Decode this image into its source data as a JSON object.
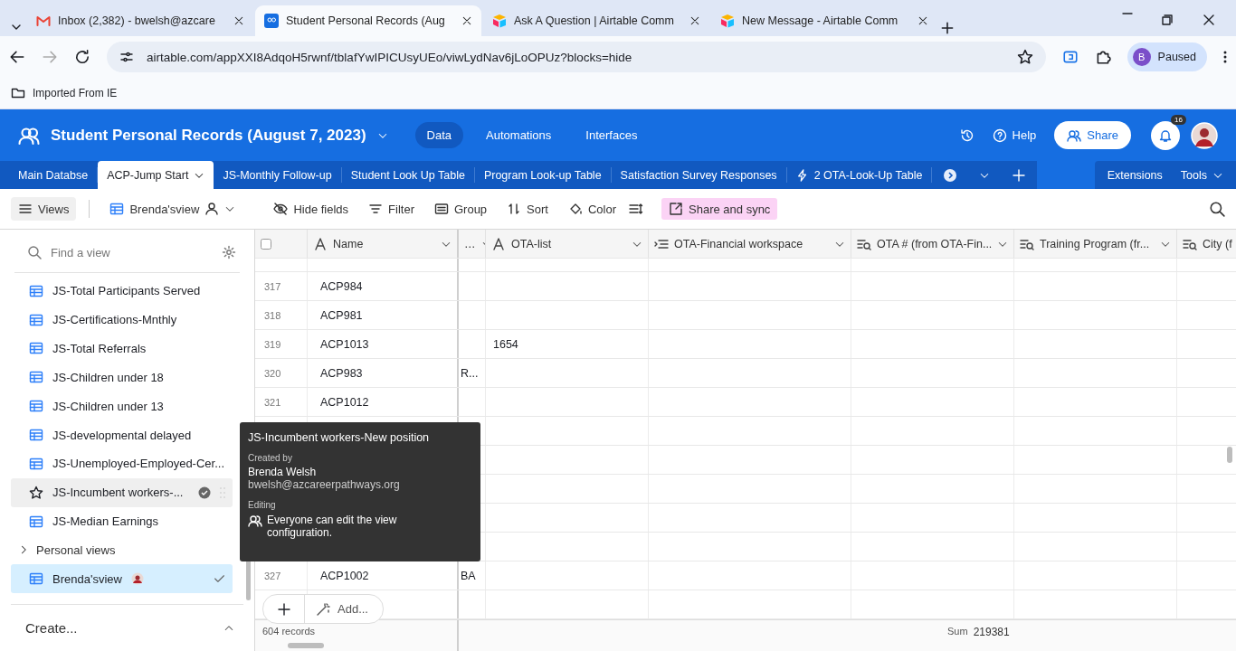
{
  "browser": {
    "tabs": [
      {
        "title": "Inbox (2,382) - bwelsh@azcare",
        "kind": "mail",
        "selected": false
      },
      {
        "title": "Student Personal Records (Aug",
        "kind": "people",
        "selected": true
      },
      {
        "title": "Ask A Question | Airtable Comm",
        "kind": "airtable",
        "selected": false
      },
      {
        "title": "New Message - Airtable Comm",
        "kind": "airtable",
        "selected": false
      }
    ],
    "address": "airtable.com/appXXI8AdqoH5rwnf/tblafYwIPICUsyUEo/viwLydNav6jLoOPUz?blocks=hide",
    "profile_initial": "B",
    "profile_label": "Paused",
    "bookmarks": [
      "Imported From IE"
    ]
  },
  "app": {
    "base_title": "Student Personal Records (August 7, 2023)",
    "nav": [
      {
        "label": "Data",
        "selected": true
      },
      {
        "label": "Automations",
        "selected": false
      },
      {
        "label": "Interfaces",
        "selected": false
      }
    ],
    "help": "Help",
    "share": "Share",
    "notifications": "16"
  },
  "table_tabs": [
    {
      "label": "Main Databse",
      "selected": false
    },
    {
      "label": "ACP-Jump Start",
      "selected": true
    },
    {
      "label": "JS-Monthly Follow-up",
      "selected": false
    },
    {
      "label": "Student Look Up Table",
      "selected": false
    },
    {
      "label": "Program Look-up Table",
      "selected": false
    },
    {
      "label": "Satisfaction Survey Responses",
      "selected": false
    },
    {
      "label": "2 OTA-Look-Up Table",
      "selected": false
    }
  ],
  "extensions": "Extensions",
  "tools": "Tools",
  "toolbar": {
    "views": "Views",
    "view_name": "Brenda'sview",
    "buttons": [
      {
        "label": "Hide fields",
        "kind": "hide"
      },
      {
        "label": "Filter",
        "kind": "filter"
      },
      {
        "label": "Group",
        "kind": "group"
      },
      {
        "label": "Sort",
        "kind": "sort"
      },
      {
        "label": "Color",
        "kind": "color"
      }
    ],
    "share_sync": "Share and sync"
  },
  "sidebar": {
    "search_placeholder": "Find a view",
    "views": [
      {
        "label": "JS-Total Participants Served",
        "selected": false,
        "hovered": false
      },
      {
        "label": "JS-Certifications-Mnthly",
        "selected": false,
        "hovered": false
      },
      {
        "label": "JS-Total Referrals",
        "selected": false,
        "hovered": false
      },
      {
        "label": "JS-Children under 18",
        "selected": false,
        "hovered": false
      },
      {
        "label": "JS-Children under 13",
        "selected": false,
        "hovered": false
      },
      {
        "label": "JS-developmental delayed",
        "selected": false,
        "hovered": false
      },
      {
        "label": "JS-Unemployed-Employed-Cer...",
        "selected": false,
        "hovered": false
      },
      {
        "label": "JS-Incumbent workers-...",
        "selected": false,
        "hovered": true
      },
      {
        "label": "JS-Median Earnings",
        "selected": false,
        "hovered": false
      }
    ],
    "personal_section": "Personal views",
    "personal_expanded": false,
    "personal_views": [
      {
        "label": "Brenda'sview",
        "selected": true
      }
    ],
    "create": "Create..."
  },
  "grid": {
    "columns": [
      {
        "label": "Name",
        "kind": "text"
      },
      {
        "label": "…",
        "kind": "narrow"
      },
      {
        "label": "OTA-list",
        "kind": "text"
      },
      {
        "label": "OTA-Financial workspace",
        "kind": "linked"
      },
      {
        "label": "OTA # (from OTA-Fin...",
        "kind": "lookup"
      },
      {
        "label": "Training Program (fr...",
        "kind": "lookup"
      },
      {
        "label": "City (f",
        "kind": "lookup"
      }
    ],
    "select_all_checked": false,
    "rows": [
      {
        "number": "317",
        "name": "ACP984"
      },
      {
        "number": "318",
        "name": "ACP981"
      },
      {
        "number": "319",
        "name": "ACP1013",
        "ota_list": "1654"
      },
      {
        "number": "320",
        "name": "ACP983",
        "column_2": "R..."
      },
      {
        "number": "321",
        "name": "ACP1012"
      },
      {},
      {},
      {},
      {},
      {},
      {
        "number": "327",
        "name": "ACP1002",
        "column_2": "BA"
      }
    ],
    "add": "Add...",
    "record_count": "604 records",
    "sum_label": "Sum",
    "sum_value": "219381"
  },
  "tooltip": {
    "title": "JS-Incumbent workers-New position",
    "created_by_label": "Created by",
    "creator_name": "Brenda Welsh",
    "creator_email": "bwelsh@azcareerpathways.org",
    "editing_label": "Editing",
    "editing_text": "Everyone can edit the view configuration."
  }
}
